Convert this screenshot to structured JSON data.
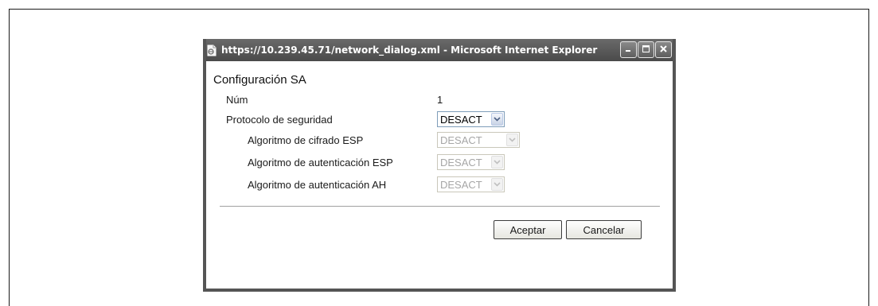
{
  "window": {
    "title": "https://10.239.45.71/network_dialog.xml - Microsoft Internet Explorer"
  },
  "dialog": {
    "heading": "Configuración SA",
    "fields": {
      "num_label": "Núm",
      "num_value": "1",
      "security_protocol_label": "Protocolo de seguridad",
      "security_protocol_value": "DESACT",
      "esp_encryption_label": "Algoritmo de cifrado ESP",
      "esp_encryption_value": "DESACT",
      "esp_auth_label": "Algoritmo de autenticación ESP",
      "esp_auth_value": "DESACT",
      "ah_auth_label": "Algoritmo de autenticación AH",
      "ah_auth_value": "DESACT"
    },
    "buttons": {
      "accept": "Aceptar",
      "cancel": "Cancelar"
    }
  },
  "icons": {
    "page": "ie-page-icon",
    "minimize": "minimize-icon",
    "maximize": "maximize-icon",
    "close": "close-icon",
    "dropdown": "chevron-down-icon"
  },
  "colors": {
    "titlebar": "#555555",
    "select_border": "#7f9db9",
    "disabled_text": "#a6a6a6"
  }
}
